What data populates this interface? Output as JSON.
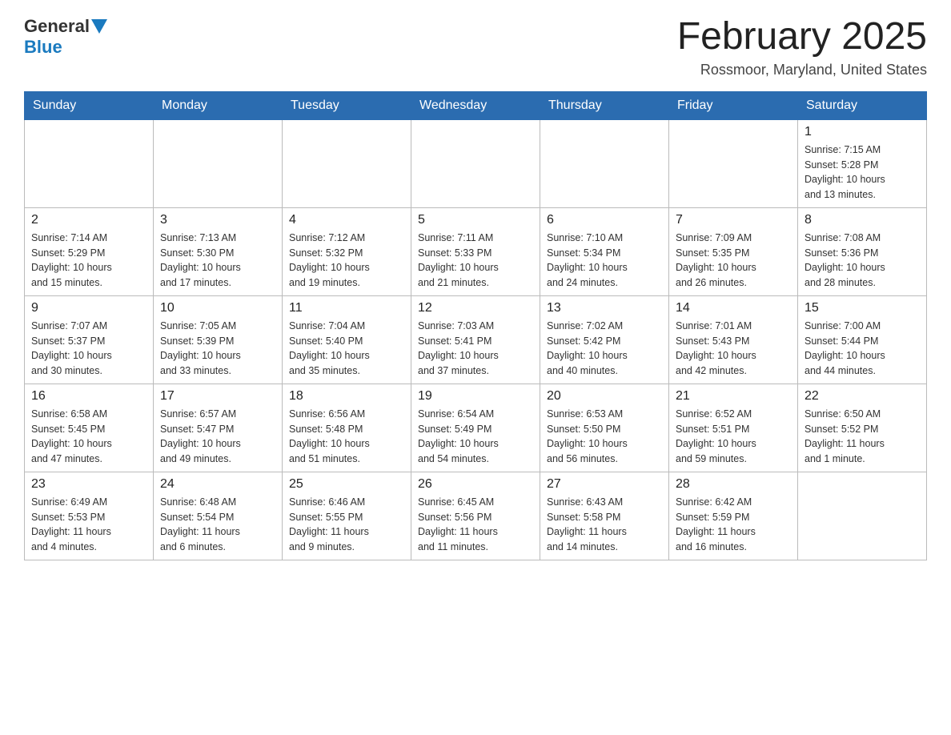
{
  "header": {
    "logo_general": "General",
    "logo_blue": "Blue",
    "month_title": "February 2025",
    "location": "Rossmoor, Maryland, United States"
  },
  "days_of_week": [
    "Sunday",
    "Monday",
    "Tuesday",
    "Wednesday",
    "Thursday",
    "Friday",
    "Saturday"
  ],
  "weeks": [
    [
      {
        "day": "",
        "info": ""
      },
      {
        "day": "",
        "info": ""
      },
      {
        "day": "",
        "info": ""
      },
      {
        "day": "",
        "info": ""
      },
      {
        "day": "",
        "info": ""
      },
      {
        "day": "",
        "info": ""
      },
      {
        "day": "1",
        "info": "Sunrise: 7:15 AM\nSunset: 5:28 PM\nDaylight: 10 hours\nand 13 minutes."
      }
    ],
    [
      {
        "day": "2",
        "info": "Sunrise: 7:14 AM\nSunset: 5:29 PM\nDaylight: 10 hours\nand 15 minutes."
      },
      {
        "day": "3",
        "info": "Sunrise: 7:13 AM\nSunset: 5:30 PM\nDaylight: 10 hours\nand 17 minutes."
      },
      {
        "day": "4",
        "info": "Sunrise: 7:12 AM\nSunset: 5:32 PM\nDaylight: 10 hours\nand 19 minutes."
      },
      {
        "day": "5",
        "info": "Sunrise: 7:11 AM\nSunset: 5:33 PM\nDaylight: 10 hours\nand 21 minutes."
      },
      {
        "day": "6",
        "info": "Sunrise: 7:10 AM\nSunset: 5:34 PM\nDaylight: 10 hours\nand 24 minutes."
      },
      {
        "day": "7",
        "info": "Sunrise: 7:09 AM\nSunset: 5:35 PM\nDaylight: 10 hours\nand 26 minutes."
      },
      {
        "day": "8",
        "info": "Sunrise: 7:08 AM\nSunset: 5:36 PM\nDaylight: 10 hours\nand 28 minutes."
      }
    ],
    [
      {
        "day": "9",
        "info": "Sunrise: 7:07 AM\nSunset: 5:37 PM\nDaylight: 10 hours\nand 30 minutes."
      },
      {
        "day": "10",
        "info": "Sunrise: 7:05 AM\nSunset: 5:39 PM\nDaylight: 10 hours\nand 33 minutes."
      },
      {
        "day": "11",
        "info": "Sunrise: 7:04 AM\nSunset: 5:40 PM\nDaylight: 10 hours\nand 35 minutes."
      },
      {
        "day": "12",
        "info": "Sunrise: 7:03 AM\nSunset: 5:41 PM\nDaylight: 10 hours\nand 37 minutes."
      },
      {
        "day": "13",
        "info": "Sunrise: 7:02 AM\nSunset: 5:42 PM\nDaylight: 10 hours\nand 40 minutes."
      },
      {
        "day": "14",
        "info": "Sunrise: 7:01 AM\nSunset: 5:43 PM\nDaylight: 10 hours\nand 42 minutes."
      },
      {
        "day": "15",
        "info": "Sunrise: 7:00 AM\nSunset: 5:44 PM\nDaylight: 10 hours\nand 44 minutes."
      }
    ],
    [
      {
        "day": "16",
        "info": "Sunrise: 6:58 AM\nSunset: 5:45 PM\nDaylight: 10 hours\nand 47 minutes."
      },
      {
        "day": "17",
        "info": "Sunrise: 6:57 AM\nSunset: 5:47 PM\nDaylight: 10 hours\nand 49 minutes."
      },
      {
        "day": "18",
        "info": "Sunrise: 6:56 AM\nSunset: 5:48 PM\nDaylight: 10 hours\nand 51 minutes."
      },
      {
        "day": "19",
        "info": "Sunrise: 6:54 AM\nSunset: 5:49 PM\nDaylight: 10 hours\nand 54 minutes."
      },
      {
        "day": "20",
        "info": "Sunrise: 6:53 AM\nSunset: 5:50 PM\nDaylight: 10 hours\nand 56 minutes."
      },
      {
        "day": "21",
        "info": "Sunrise: 6:52 AM\nSunset: 5:51 PM\nDaylight: 10 hours\nand 59 minutes."
      },
      {
        "day": "22",
        "info": "Sunrise: 6:50 AM\nSunset: 5:52 PM\nDaylight: 11 hours\nand 1 minute."
      }
    ],
    [
      {
        "day": "23",
        "info": "Sunrise: 6:49 AM\nSunset: 5:53 PM\nDaylight: 11 hours\nand 4 minutes."
      },
      {
        "day": "24",
        "info": "Sunrise: 6:48 AM\nSunset: 5:54 PM\nDaylight: 11 hours\nand 6 minutes."
      },
      {
        "day": "25",
        "info": "Sunrise: 6:46 AM\nSunset: 5:55 PM\nDaylight: 11 hours\nand 9 minutes."
      },
      {
        "day": "26",
        "info": "Sunrise: 6:45 AM\nSunset: 5:56 PM\nDaylight: 11 hours\nand 11 minutes."
      },
      {
        "day": "27",
        "info": "Sunrise: 6:43 AM\nSunset: 5:58 PM\nDaylight: 11 hours\nand 14 minutes."
      },
      {
        "day": "28",
        "info": "Sunrise: 6:42 AM\nSunset: 5:59 PM\nDaylight: 11 hours\nand 16 minutes."
      },
      {
        "day": "",
        "info": ""
      }
    ]
  ]
}
